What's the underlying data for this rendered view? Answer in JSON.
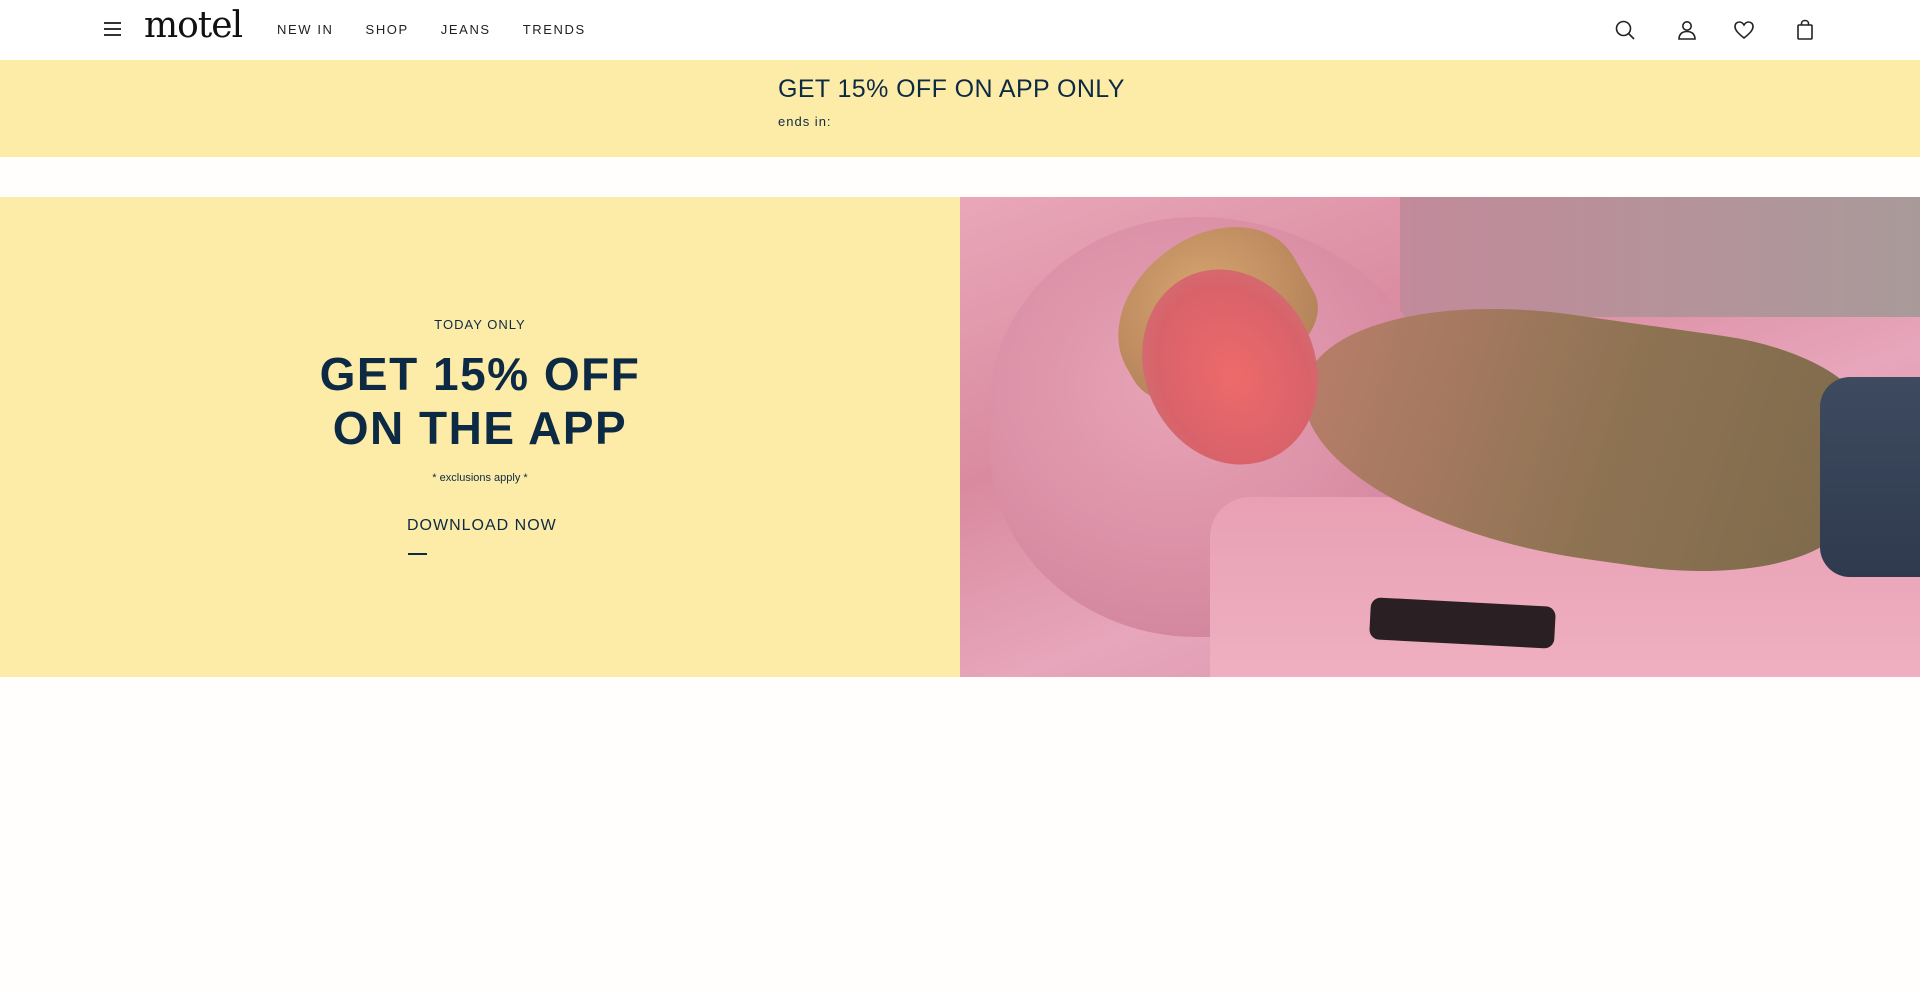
{
  "header": {
    "logo": "motel",
    "nav": [
      "NEW IN",
      "SHOP",
      "JEANS",
      "TRENDS"
    ],
    "icons": [
      "menu-icon",
      "search-icon",
      "account-icon",
      "wishlist-heart-icon",
      "bag-icon"
    ]
  },
  "promo_bar": {
    "title": "GET 15% OFF ON APP ONLY",
    "ends_in": "ends in:"
  },
  "hero": {
    "eyebrow": "TODAY ONLY",
    "headline_line1": "GET 15% OFF",
    "headline_line2": "ON THE APP",
    "disclaimer": "* exclusions apply *",
    "cta": "DOWNLOAD NOW"
  },
  "colors": {
    "accent_yellow": "#fdeca8",
    "text_navy": "#0d2a44"
  }
}
